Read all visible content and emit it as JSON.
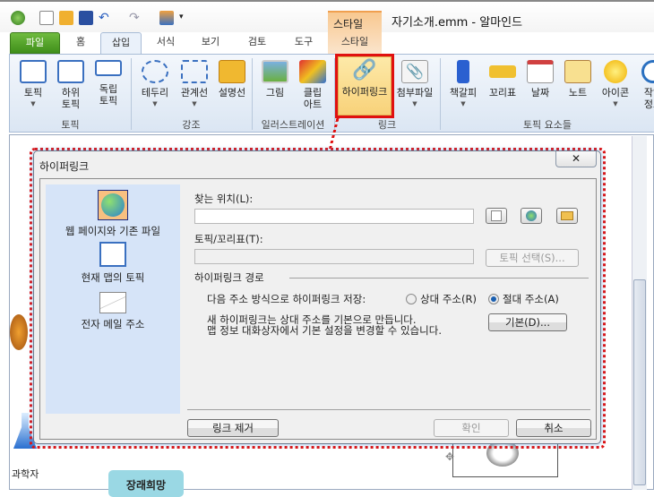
{
  "app": {
    "title": "자기소개.emm - 알마인드",
    "context_tab_header": "스타일"
  },
  "tabs": [
    {
      "label": "파일"
    },
    {
      "label": "홈"
    },
    {
      "label": "삽입"
    },
    {
      "label": "서식"
    },
    {
      "label": "보기"
    },
    {
      "label": "검토"
    },
    {
      "label": "도구"
    },
    {
      "label": "스타일"
    }
  ],
  "ribbon": {
    "buttons": [
      {
        "label": "토픽"
      },
      {
        "label": "하위\n토픽"
      },
      {
        "label": "독립\n토픽"
      },
      {
        "label": "테두리"
      },
      {
        "label": "관계선"
      },
      {
        "label": "설명선"
      },
      {
        "label": "그림"
      },
      {
        "label": "클립\n아트"
      },
      {
        "label": "하이퍼링크"
      },
      {
        "label": "첨부파일"
      },
      {
        "label": "책갈피"
      },
      {
        "label": "꼬리표"
      },
      {
        "label": "날짜"
      },
      {
        "label": "노트"
      },
      {
        "label": "아이콘"
      },
      {
        "label": "작업\n정보"
      }
    ],
    "groups": [
      {
        "label": "토픽"
      },
      {
        "label": "강조"
      },
      {
        "label": "일러스트레이션"
      },
      {
        "label": "링크"
      },
      {
        "label": "토픽 요소들"
      }
    ]
  },
  "dialog": {
    "title": "하이퍼링크",
    "close": "✕",
    "link_types": [
      {
        "label": "웹 페이지와 기존 파일"
      },
      {
        "label": "현재 맵의 토픽"
      },
      {
        "label": "전자 메일 주소"
      }
    ],
    "location_label": "찾는 위치(L):",
    "location_value": "",
    "topic_label": "토픽/꼬리표(T):",
    "topic_value": "",
    "select_topic": "토픽 선택(S)...",
    "path_section": "하이퍼링크 경로",
    "save_as_label": "다음 주소 방식으로 하이퍼링크 저장:",
    "relative": "상대 주소(R)",
    "absolute": "절대 주소(A)",
    "selected": "absolute",
    "info_line1": "새 하이퍼링크는 상대 주소를 기본으로 만듭니다.",
    "info_line2": "맵 정보 대화상자에서 기본 설정을 변경할 수 있습니다.",
    "default_btn": "기본(D)...",
    "remove_link": "링크 제거",
    "ok": "확인",
    "cancel": "취소"
  },
  "canvas": {
    "topic1": "과학자",
    "topic2": "장래희망"
  }
}
